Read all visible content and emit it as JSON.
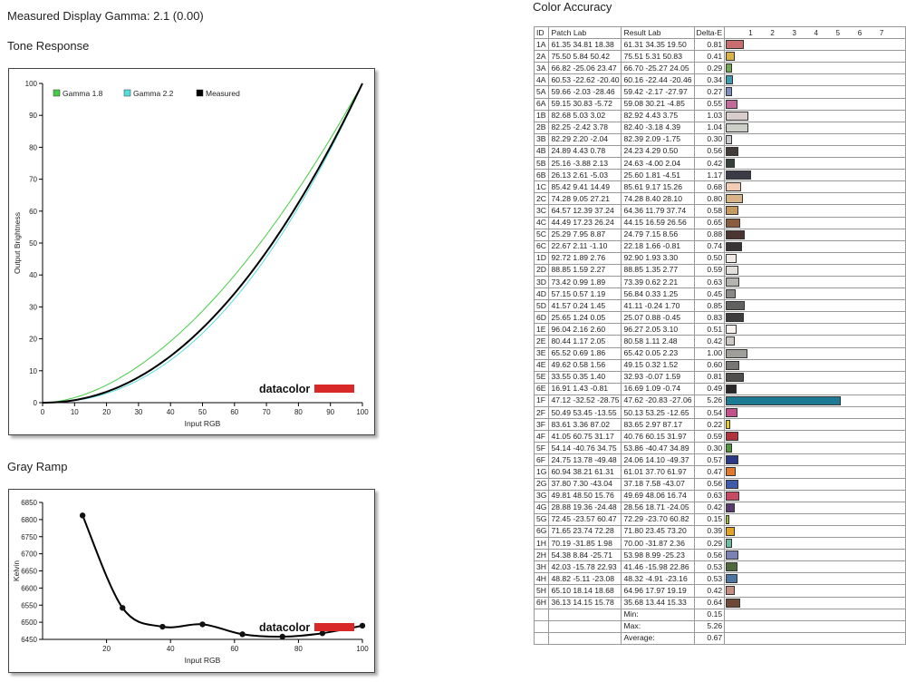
{
  "header": {
    "title": "Measured Display Gamma: 2.1 (0.00)"
  },
  "tone": {
    "title": "Tone Response",
    "brand": "datacolor"
  },
  "gray": {
    "title": "Gray Ramp",
    "brand": "datacolor"
  },
  "accuracy": {
    "title": "Color Accuracy",
    "col_id": "ID",
    "col_patch": "Patch Lab",
    "col_result": "Result Lab",
    "col_de": "Delta-E",
    "bar_ticks": [
      "1",
      "2",
      "3",
      "4",
      "5",
      "6",
      "7"
    ],
    "min_label": "Min:",
    "min_value": "0.15",
    "max_label": "Max:",
    "max_value": "5.26",
    "avg_label": "Average:",
    "avg_value": "0.67"
  },
  "chart_data": [
    {
      "type": "line",
      "title": "Tone Response",
      "xlabel": "Input RGB",
      "ylabel": "Output Brightness",
      "xlim": [
        0,
        100
      ],
      "ylim": [
        0,
        100
      ],
      "xticks": [
        "0",
        "10",
        "20",
        "30",
        "40",
        "50",
        "60",
        "70",
        "80",
        "90",
        "100"
      ],
      "yticks": [
        "0",
        "10",
        "20",
        "30",
        "40",
        "50",
        "60",
        "70",
        "80",
        "90",
        "100"
      ],
      "legend": "top-left",
      "series": [
        {
          "name": "Gamma 1.8",
          "color": "#44cc44",
          "gamma": 1.8
        },
        {
          "name": "Gamma 2.2",
          "color": "#55dddd",
          "gamma": 2.2
        },
        {
          "name": "Measured",
          "color": "#000000",
          "gamma": 2.1
        }
      ]
    },
    {
      "type": "line",
      "title": "Gray Ramp",
      "xlabel": "Input RGB",
      "ylabel": "Kelvin",
      "xlim": [
        0,
        100
      ],
      "ylim": [
        6450,
        6850
      ],
      "xticks": [
        "20",
        "40",
        "60",
        "80",
        "100"
      ],
      "yticks": [
        "6450",
        "6500",
        "6550",
        "6600",
        "6650",
        "6700",
        "6750",
        "6800",
        "6850"
      ],
      "x": [
        12.5,
        25,
        37.5,
        50,
        62.5,
        75,
        87.5,
        100
      ],
      "y": [
        6812,
        6542,
        6487,
        6494,
        6465,
        6458,
        6468,
        6490
      ]
    },
    {
      "type": "bar",
      "title": "Color Accuracy",
      "xlim": [
        0,
        7
      ],
      "rows": [
        [
          "1A",
          "61.35",
          "34.81",
          "18.38",
          "61.31",
          "34.35",
          "19.50",
          "0.81",
          "#c86d6d"
        ],
        [
          "2A",
          "75.50",
          "5.84",
          "50.42",
          "75.51",
          "5.31",
          "50.83",
          "0.41",
          "#d9b24a"
        ],
        [
          "3A",
          "66.82",
          "-25.06",
          "23.47",
          "66.70",
          "-25.27",
          "24.05",
          "0.29",
          "#74a954"
        ],
        [
          "4A",
          "60.53",
          "-22.62",
          "-20.40",
          "60.16",
          "-22.44",
          "-20.46",
          "0.34",
          "#3e9bb0"
        ],
        [
          "5A",
          "59.66",
          "-2.03",
          "-28.46",
          "59.42",
          "-2.17",
          "-27.97",
          "0.27",
          "#7a8fc0"
        ],
        [
          "6A",
          "59.15",
          "30.83",
          "-5.72",
          "59.08",
          "30.21",
          "-4.85",
          "0.55",
          "#c26a9a"
        ],
        [
          "1B",
          "82.68",
          "5.03",
          "3.02",
          "82.92",
          "4.43",
          "3.75",
          "1.03",
          "#d9cccc"
        ],
        [
          "2B",
          "82.25",
          "-2.42",
          "3.78",
          "82.40",
          "-3.18",
          "4.39",
          "1.04",
          "#cccfc8"
        ],
        [
          "3B",
          "82.29",
          "2.20",
          "-2.04",
          "82.39",
          "2.09",
          "-1.75",
          "0.30",
          "#ccc9cf"
        ],
        [
          "4B",
          "24.89",
          "4.43",
          "0.78",
          "24.23",
          "4.29",
          "0.50",
          "0.56",
          "#433a3a"
        ],
        [
          "5B",
          "25.16",
          "-3.88",
          "2.13",
          "24.63",
          "-4.00",
          "2.04",
          "0.42",
          "#36403a"
        ],
        [
          "6B",
          "26.13",
          "2.61",
          "-5.03",
          "25.60",
          "1.81",
          "-4.51",
          "1.17",
          "#3a3b46"
        ],
        [
          "1C",
          "85.42",
          "9.41",
          "14.49",
          "85.61",
          "9.17",
          "15.26",
          "0.68",
          "#f2cdb4"
        ],
        [
          "2C",
          "74.28",
          "9.05",
          "27.21",
          "74.28",
          "8.40",
          "28.10",
          "0.80",
          "#d9b486"
        ],
        [
          "3C",
          "64.57",
          "12.39",
          "37.24",
          "64.36",
          "11.79",
          "37.74",
          "0.58",
          "#c39a62"
        ],
        [
          "4C",
          "44.49",
          "17.23",
          "26.24",
          "44.15",
          "16.59",
          "26.56",
          "0.65",
          "#8a5c3e"
        ],
        [
          "5C",
          "25.29",
          "7.95",
          "8.87",
          "24.79",
          "7.15",
          "8.56",
          "0.88",
          "#4a3530"
        ],
        [
          "6C",
          "22.67",
          "2.11",
          "-1.10",
          "22.18",
          "1.66",
          "-0.81",
          "0.74",
          "#383436"
        ],
        [
          "1D",
          "92.72",
          "1.89",
          "2.76",
          "92.90",
          "1.93",
          "3.30",
          "0.50",
          "#eeeae6"
        ],
        [
          "2D",
          "88.85",
          "1.59",
          "2.27",
          "88.85",
          "1.35",
          "2.77",
          "0.59",
          "#e2dedb"
        ],
        [
          "3D",
          "73.42",
          "0.99",
          "1.89",
          "73.39",
          "0.62",
          "2.21",
          "0.63",
          "#b5b3b0"
        ],
        [
          "4D",
          "57.15",
          "0.57",
          "1.19",
          "56.84",
          "0.33",
          "1.25",
          "0.45",
          "#8a8988"
        ],
        [
          "5D",
          "41.57",
          "0.24",
          "1.45",
          "41.11",
          "-0.24",
          "1.70",
          "0.85",
          "#616160"
        ],
        [
          "6D",
          "25.65",
          "1.24",
          "0.05",
          "25.07",
          "0.88",
          "-0.45",
          "0.83",
          "#3e3c3d"
        ],
        [
          "1E",
          "96.04",
          "2.16",
          "2.60",
          "96.27",
          "2.05",
          "3.10",
          "0.51",
          "#f7f3f0"
        ],
        [
          "2E",
          "80.44",
          "1.17",
          "2.05",
          "80.58",
          "1.11",
          "2.48",
          "0.42",
          "#cbc8c5"
        ],
        [
          "3E",
          "65.52",
          "0.69",
          "1.86",
          "65.42",
          "0.05",
          "2.23",
          "1.00",
          "#a09e9b"
        ],
        [
          "4E",
          "49.62",
          "0.58",
          "1.56",
          "49.15",
          "0.32",
          "1.52",
          "0.60",
          "#787675"
        ],
        [
          "5E",
          "33.55",
          "0.35",
          "1.40",
          "32.93",
          "-0.07",
          "1.59",
          "0.81",
          "#4f4e4d"
        ],
        [
          "6E",
          "16.91",
          "1.43",
          "-0.81",
          "16.69",
          "1.09",
          "-0.74",
          "0.49",
          "#2a2829"
        ],
        [
          "1F",
          "47.12",
          "-32.52",
          "-28.75",
          "47.62",
          "-20.83",
          "-27.06",
          "5.26",
          "#1c7a93"
        ],
        [
          "2F",
          "50.49",
          "53.45",
          "-13.55",
          "50.13",
          "53.25",
          "-12.65",
          "0.54",
          "#c2508c"
        ],
        [
          "3F",
          "83.61",
          "3.36",
          "87.02",
          "83.65",
          "2.97",
          "87.17",
          "0.22",
          "#e6cc1e"
        ],
        [
          "4F",
          "41.05",
          "60.75",
          "31.17",
          "40.76",
          "60.15",
          "31.97",
          "0.59",
          "#b0323a"
        ],
        [
          "5F",
          "54.14",
          "-40.76",
          "34.75",
          "53.86",
          "-40.47",
          "34.89",
          "0.30",
          "#4e9640"
        ],
        [
          "6F",
          "24.75",
          "13.78",
          "-49.48",
          "24.06",
          "14.10",
          "-49.37",
          "0.57",
          "#2a3886"
        ],
        [
          "1G",
          "60.94",
          "38.21",
          "61.31",
          "61.01",
          "37.70",
          "61.97",
          "0.47",
          "#e07a2a"
        ],
        [
          "2G",
          "37.80",
          "7.30",
          "-43.04",
          "37.18",
          "7.58",
          "-43.07",
          "0.56",
          "#3e5aa8"
        ],
        [
          "3G",
          "49.81",
          "48.50",
          "15.76",
          "49.69",
          "48.06",
          "16.74",
          "0.63",
          "#c84a62"
        ],
        [
          "4G",
          "28.88",
          "19.36",
          "-24.48",
          "28.56",
          "18.71",
          "-24.05",
          "0.42",
          "#5a3a6e"
        ],
        [
          "5G",
          "72.45",
          "-23.57",
          "60.47",
          "72.29",
          "-23.70",
          "60.82",
          "0.15",
          "#9ebc3c"
        ],
        [
          "6G",
          "71.65",
          "23.74",
          "72.28",
          "71.80",
          "23.45",
          "73.20",
          "0.39",
          "#e4a226"
        ],
        [
          "1H",
          "70.19",
          "-31.85",
          "1.98",
          "70.00",
          "-31.87",
          "2.36",
          "0.29",
          "#6cbca0"
        ],
        [
          "2H",
          "54.38",
          "8.84",
          "-25.71",
          "53.98",
          "8.99",
          "-25.23",
          "0.56",
          "#7a82b4"
        ],
        [
          "3H",
          "42.03",
          "-15.78",
          "22.93",
          "41.46",
          "-15.98",
          "22.86",
          "0.53",
          "#4e6a3a"
        ],
        [
          "4H",
          "48.82",
          "-5.11",
          "-23.08",
          "48.32",
          "-4.91",
          "-23.16",
          "0.53",
          "#4e74a0"
        ],
        [
          "5H",
          "65.10",
          "18.14",
          "18.68",
          "64.96",
          "17.97",
          "19.19",
          "0.42",
          "#c48e80"
        ],
        [
          "6H",
          "36.13",
          "14.15",
          "15.78",
          "35.68",
          "13.44",
          "15.33",
          "0.64",
          "#6e4836"
        ]
      ]
    }
  ]
}
